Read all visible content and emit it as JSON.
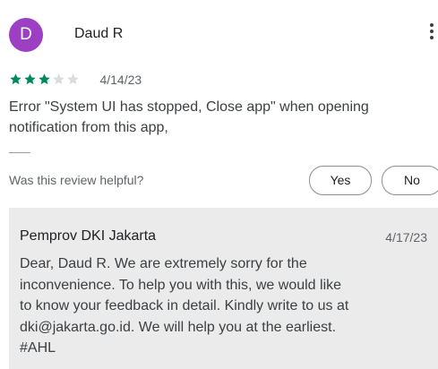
{
  "review": {
    "avatar_letter": "D",
    "avatar_color": "#9c3fc2",
    "reviewer_name": "Daud R",
    "menu_icon": "more-vert-icon",
    "rating": 3,
    "max_rating": 5,
    "star_filled_color": "#01875f",
    "star_empty_color": "#dadce0",
    "date": "4/14/23",
    "text_lines": [
      "Error \"System UI has stopped, Close app\" when opening",
      "notification from this app,"
    ],
    "helpful_prompt": "Was this review helpful?",
    "yes_label": "Yes",
    "no_label": "No"
  },
  "developer_reply": {
    "developer_name": "Pemprov DKI Jakarta",
    "date": "4/17/23",
    "text_lines": [
      "Dear, Daud R. We are extremely sorry for the",
      "inconvenience. To help you with this, we would like",
      "to know your feedback in detail. Kindly write to us at",
      "dki@jakarta.go.id. We will help you at the earliest.",
      "#AHL"
    ]
  }
}
